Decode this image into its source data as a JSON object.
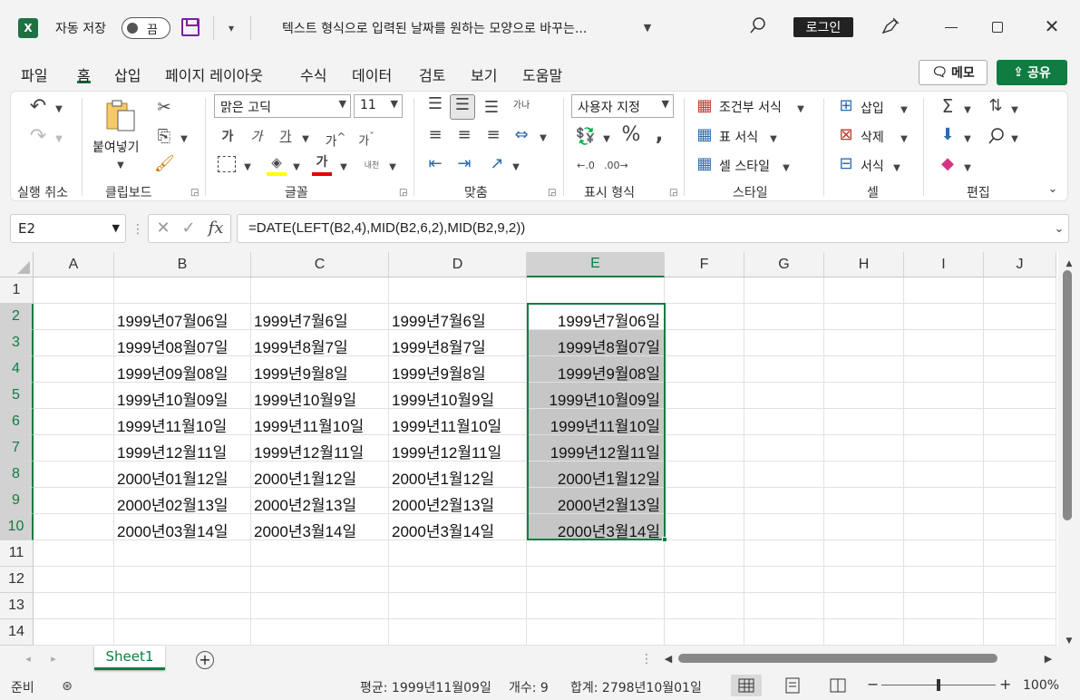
{
  "titlebar": {
    "app_icon": "X",
    "autosave_label": "자동 저장",
    "autosave_state": "끔",
    "doc_title": "텍스트 형식으로 입력된 날짜를 원하는 모양으로 바꾸는...",
    "login_label": "로그인"
  },
  "menu": {
    "items": [
      "파일",
      "홈",
      "삽입",
      "페이지 레이아웃",
      "수식",
      "데이터",
      "검토",
      "보기",
      "도움말"
    ],
    "active": "홈",
    "memo_label": "메모",
    "share_label": "공유"
  },
  "ribbon": {
    "undo_group": "실행 취소",
    "clipboard_group": "클립보드",
    "paste_label": "붙여넣기",
    "font_group": "글꼴",
    "font_name": "맑은 고딕",
    "font_size": "11",
    "bold": "가",
    "italic": "가",
    "underline": "가",
    "grow": "가",
    "shrink": "가",
    "phonetic": "내천",
    "font_color_glyph": "가",
    "align_group": "맞춤",
    "wrap_glyph": "가나",
    "number_group": "표시 형식",
    "number_format": "사용자 지정",
    "styles_group": "스타일",
    "cond_format": "조건부 서식",
    "table_format": "표 서식",
    "cell_style": "셀 스타일",
    "cells_group": "셀",
    "insert": "삽입",
    "delete": "삭제",
    "format": "서식",
    "edit_group": "편집"
  },
  "formula_bar": {
    "name_box": "E2",
    "formula": "=DATE(LEFT(B2,4),MID(B2,6,2),MID(B2,9,2))"
  },
  "grid": {
    "columns": [
      "A",
      "B",
      "C",
      "D",
      "E",
      "F",
      "G",
      "H",
      "I",
      "J"
    ],
    "selected_column": "E",
    "rows": [
      "1",
      "2",
      "3",
      "4",
      "5",
      "6",
      "7",
      "8",
      "9",
      "10",
      "11",
      "12",
      "13",
      "14"
    ],
    "data": [
      [
        "1999년07월06일",
        "1999년7월6일",
        "1999년7월6일",
        "1999년7월06일"
      ],
      [
        "1999년08월07일",
        "1999년8월7일",
        "1999년8월7일",
        "1999년8월07일"
      ],
      [
        "1999년09월08일",
        "1999년9월8일",
        "1999년9월8일",
        "1999년9월08일"
      ],
      [
        "1999년10월09일",
        "1999년10월9일",
        "1999년10월9일",
        "1999년10월09일"
      ],
      [
        "1999년11월10일",
        "1999년11월10일",
        "1999년11월10일",
        "1999년11월10일"
      ],
      [
        "1999년12월11일",
        "1999년12월11일",
        "1999년12월11일",
        "1999년12월11일"
      ],
      [
        "2000년01월12일",
        "2000년1월12일",
        "2000년1월12일",
        "2000년1월12일"
      ],
      [
        "2000년02월13일",
        "2000년2월13일",
        "2000년2월13일",
        "2000년2월13일"
      ],
      [
        "2000년03월14일",
        "2000년3월14일",
        "2000년3월14일",
        "2000년3월14일"
      ]
    ]
  },
  "sheet_tab": "Sheet1",
  "status": {
    "ready": "준비",
    "average": "평균: 1999년11월09일",
    "count": "개수: 9",
    "sum": "합계: 2798년10월01일",
    "zoom": "100%",
    "zoom_fraction": 0.5
  },
  "colors": {
    "accent": "#107c41",
    "selection_fill": "#c6c6c6"
  }
}
